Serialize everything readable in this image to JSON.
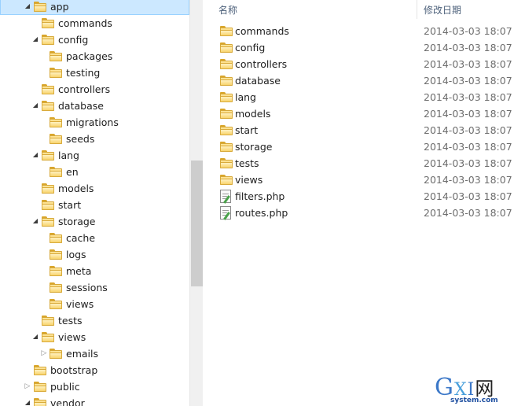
{
  "tree": {
    "items": [
      {
        "label": "app",
        "level": 1,
        "expander": "expanded",
        "selected": true
      },
      {
        "label": "commands",
        "level": 2,
        "expander": "none"
      },
      {
        "label": "config",
        "level": 2,
        "expander": "expanded"
      },
      {
        "label": "packages",
        "level": 3,
        "expander": "none"
      },
      {
        "label": "testing",
        "level": 3,
        "expander": "none"
      },
      {
        "label": "controllers",
        "level": 2,
        "expander": "none"
      },
      {
        "label": "database",
        "level": 2,
        "expander": "expanded"
      },
      {
        "label": "migrations",
        "level": 3,
        "expander": "none"
      },
      {
        "label": "seeds",
        "level": 3,
        "expander": "none"
      },
      {
        "label": "lang",
        "level": 2,
        "expander": "expanded"
      },
      {
        "label": "en",
        "level": 3,
        "expander": "none"
      },
      {
        "label": "models",
        "level": 2,
        "expander": "none"
      },
      {
        "label": "start",
        "level": 2,
        "expander": "none"
      },
      {
        "label": "storage",
        "level": 2,
        "expander": "expanded"
      },
      {
        "label": "cache",
        "level": 3,
        "expander": "none"
      },
      {
        "label": "logs",
        "level": 3,
        "expander": "none"
      },
      {
        "label": "meta",
        "level": 3,
        "expander": "none"
      },
      {
        "label": "sessions",
        "level": 3,
        "expander": "none"
      },
      {
        "label": "views",
        "level": 3,
        "expander": "none"
      },
      {
        "label": "tests",
        "level": 2,
        "expander": "none"
      },
      {
        "label": "views",
        "level": 2,
        "expander": "expanded"
      },
      {
        "label": "emails",
        "level": 3,
        "expander": "collapsed"
      },
      {
        "label": "bootstrap",
        "level": 1,
        "expander": "none"
      },
      {
        "label": "public",
        "level": 1,
        "expander": "collapsed"
      },
      {
        "label": "vendor",
        "level": 1,
        "expander": "expanded"
      }
    ]
  },
  "list": {
    "headers": {
      "name": "名称",
      "date": "修改日期"
    },
    "rows": [
      {
        "name": "commands",
        "date": "2014-03-03 18:07",
        "icon": "folder-icon"
      },
      {
        "name": "config",
        "date": "2014-03-03 18:07",
        "icon": "folder-icon"
      },
      {
        "name": "controllers",
        "date": "2014-03-03 18:07",
        "icon": "folder-icon"
      },
      {
        "name": "database",
        "date": "2014-03-03 18:07",
        "icon": "folder-icon"
      },
      {
        "name": "lang",
        "date": "2014-03-03 18:07",
        "icon": "folder-icon"
      },
      {
        "name": "models",
        "date": "2014-03-03 18:07",
        "icon": "folder-icon"
      },
      {
        "name": "start",
        "date": "2014-03-03 18:07",
        "icon": "folder-icon"
      },
      {
        "name": "storage",
        "date": "2014-03-03 18:07",
        "icon": "folder-icon"
      },
      {
        "name": "tests",
        "date": "2014-03-03 18:07",
        "icon": "folder-icon"
      },
      {
        "name": "views",
        "date": "2014-03-03 18:07",
        "icon": "folder-icon"
      },
      {
        "name": "filters.php",
        "date": "2014-03-03 18:07",
        "icon": "php-file-icon"
      },
      {
        "name": "routes.php",
        "date": "2014-03-03 18:07",
        "icon": "php-file-icon"
      }
    ]
  },
  "watermark": {
    "letters": [
      "G",
      "X",
      "I",
      "网"
    ],
    "domain": "system.com"
  },
  "colors": {
    "selection": "#cce8ff",
    "selection_border": "#99d1ff",
    "header_text": "#4c607a",
    "folder": "#f3c554"
  }
}
